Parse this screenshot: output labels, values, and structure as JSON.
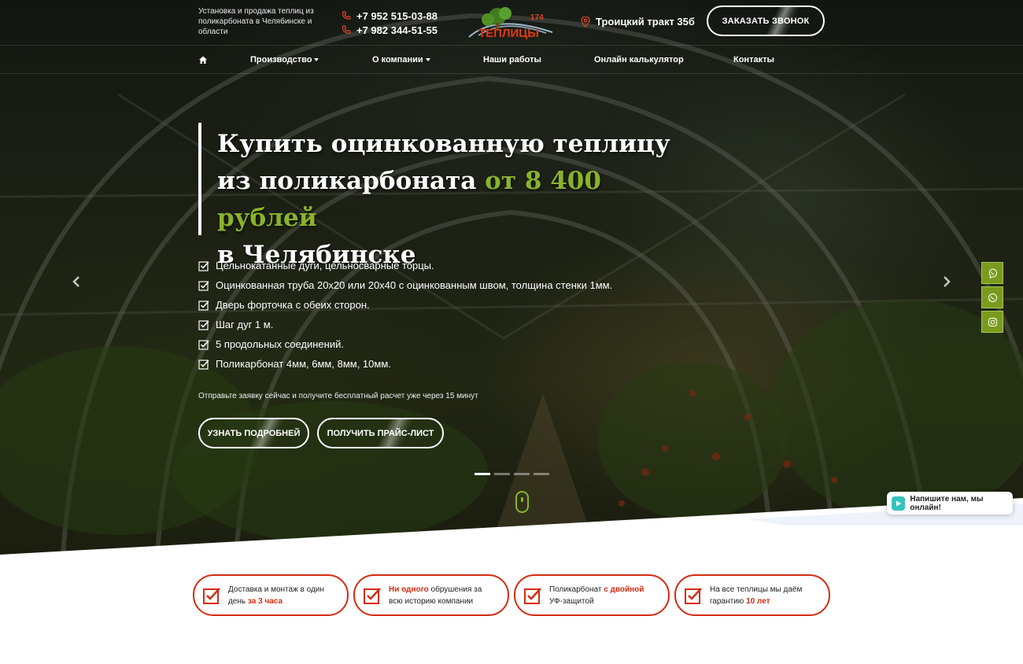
{
  "header": {
    "tagline": "Установка и продажа теплиц из поликарбоната в Челябинске и области",
    "phones": [
      "+7 952 515-03-88",
      "+7 982 344-51-55"
    ],
    "logo": {
      "text": "ТЕПЛИЦЫ",
      "number": "174"
    },
    "address": "Троицкий тракт 35б",
    "call_button": "ЗАКАЗАТЬ ЗВОНОК"
  },
  "nav": {
    "home_icon": "home-icon",
    "items": [
      {
        "label": "Производство",
        "dropdown": true
      },
      {
        "label": "О компании",
        "dropdown": true
      },
      {
        "label": "Наши работы",
        "dropdown": false
      },
      {
        "label": "Онлайн калькулятор",
        "dropdown": false
      },
      {
        "label": "Контакты",
        "dropdown": false
      }
    ]
  },
  "hero": {
    "title_line1": "Купить оцинкованную теплицу",
    "title_line2": "из поликарбоната ",
    "title_accent": "от 8 400 рублей",
    "title_line3": "в Челябинске",
    "features": [
      "Цельнокатанные дуги, цельносварные торцы.",
      "Оцинкованная труба 20х20 или 20х40 с оцинкованным швом, толщина стенки 1мм.",
      "Дверь форточка с обеих сторон.",
      "Шаг дуг 1 м.",
      "5 продольных соединений.",
      "Поликарбонат 4мм, 6мм, 8мм, 10мм."
    ],
    "hint": "Отправьте заявку сейчас и получите бесплатный расчет уже через 15 минут",
    "btn_more": "УЗНАТЬ ПОДРОБНЕЙ",
    "btn_price": "ПОЛУЧИТЬ ПРАЙС-ЛИСТ",
    "slides_count": 4,
    "active_slide": 1
  },
  "social": [
    "viber-icon",
    "whatsapp-icon",
    "instagram-icon"
  ],
  "chat": {
    "label": "Напишите нам, мы онлайн!"
  },
  "advantages": [
    {
      "pre": "Доставка и монтаж в один день ",
      "accent": "за 3 часа",
      "post": ""
    },
    {
      "pre": "",
      "accent": "Ни одного",
      "post": " обрушения за всю историю компании"
    },
    {
      "pre": "Поликарбонат ",
      "accent": "с двойной",
      "post": " УФ-защитой"
    },
    {
      "pre": "На все теплицы мы даём гарантию ",
      "accent": "10 лет",
      "post": ""
    }
  ],
  "colors": {
    "accent_green": "#8ab32a",
    "accent_red": "#d42c12"
  }
}
